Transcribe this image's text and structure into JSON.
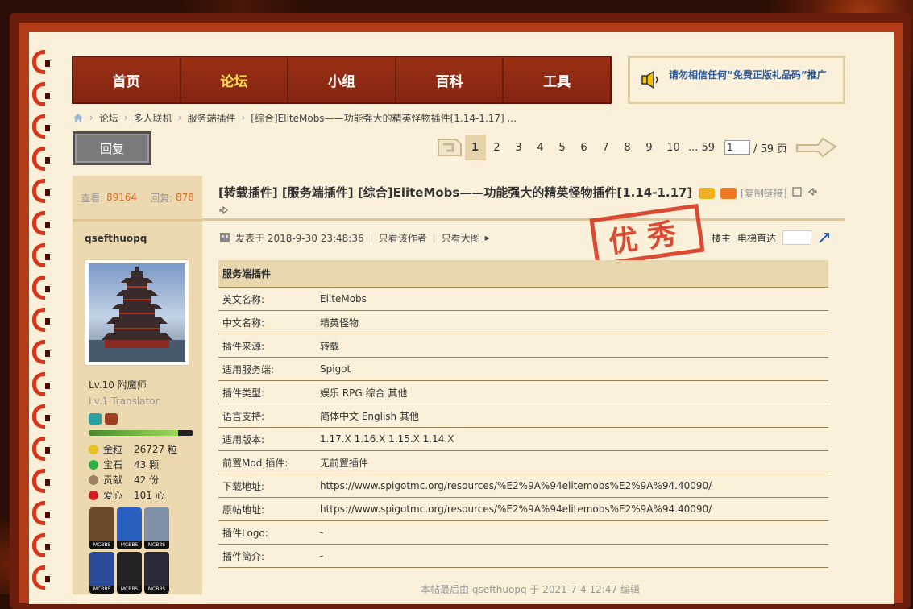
{
  "nav": {
    "items": [
      {
        "label": "首页",
        "active": false
      },
      {
        "label": "论坛",
        "active": true
      },
      {
        "label": "小组",
        "active": false
      },
      {
        "label": "百科",
        "active": false
      },
      {
        "label": "工具",
        "active": false
      }
    ]
  },
  "notice": {
    "text": "请勿相信任何“免费正版礼品码”推广"
  },
  "breadcrumb": {
    "items": [
      "论坛",
      "多人联机",
      "服务端插件",
      "[综合]EliteMobs——功能强大的精英怪物插件[1.14-1.17] ..."
    ]
  },
  "reply_button": "回复",
  "pager": {
    "pages": [
      "1",
      "2",
      "3",
      "4",
      "5",
      "6",
      "7",
      "8",
      "9",
      "10",
      "... 59"
    ],
    "current": "1",
    "input_value": "1",
    "total": "/ 59 页"
  },
  "sidebar": {
    "views_label": "查看:",
    "views": "89164",
    "replies_label": "回复:",
    "replies": "878",
    "username": "qsefthuopq",
    "level": "Lv.10 附魔师",
    "sub_level": "Lv.1 Translator",
    "progress_fraction": 0.85,
    "points": [
      {
        "icon": "gold-coin-icon",
        "label": "金粒",
        "value": "26727 粒",
        "color": "#e8c020"
      },
      {
        "icon": "gem-icon",
        "label": "宝石",
        "value": "43 颗",
        "color": "#30b040"
      },
      {
        "icon": "contribution-icon",
        "label": "贡献",
        "value": "42 份",
        "color": "#a08060"
      },
      {
        "icon": "heart-icon",
        "label": "爱心",
        "value": "101 心",
        "color": "#d02020"
      }
    ],
    "badges": [
      "MCBBS",
      "MCBBS",
      "MCBBS",
      "MCBBS",
      "MCBBS",
      "MCBBS"
    ],
    "badge_colors": [
      "#6a4a2a",
      "#2a60c0",
      "#8090a8",
      "#2a4a9a",
      "#222222",
      "#2a2a3a"
    ]
  },
  "post": {
    "title": "[转载插件] [服务端插件] [综合]EliteMobs——功能强大的精英怪物插件[1.14-1.17]",
    "copy_link": "[复制链接]",
    "posted": "发表于 2018-9-30 23:48:36",
    "only_author": "只看该作者",
    "large_image": "只看大图",
    "floor_label": "楼主",
    "jump_label": "电梯直达",
    "stamp": "优秀",
    "table_header": "服务端插件",
    "rows": [
      {
        "k": "英文名称:",
        "v": "EliteMobs"
      },
      {
        "k": "中文名称:",
        "v": "精英怪物"
      },
      {
        "k": "插件来源:",
        "v": "转载"
      },
      {
        "k": "适用服务端:",
        "v": "Spigot"
      },
      {
        "k": "插件类型:",
        "v": "娱乐 RPG 综合 其他"
      },
      {
        "k": "语言支持:",
        "v": "简体中文 English 其他"
      },
      {
        "k": "适用版本:",
        "v": "1.17.X 1.16.X 1.15.X 1.14.X"
      },
      {
        "k": "前置Mod|插件:",
        "v": "无前置插件"
      },
      {
        "k": "下载地址:",
        "v": "https://www.spigotmc.org/resources/%E2%9A%94elitemobs%E2%9A%94.40090/"
      },
      {
        "k": "原帖地址:",
        "v": "https://www.spigotmc.org/resources/%E2%9A%94elitemobs%E2%9A%94.40090/"
      },
      {
        "k": "插件Logo:",
        "v": "-"
      },
      {
        "k": "插件简介:",
        "v": "-"
      }
    ],
    "edited": "本帖最后由 qsefthuopq 于 2021-7-4 12:47 编辑"
  }
}
